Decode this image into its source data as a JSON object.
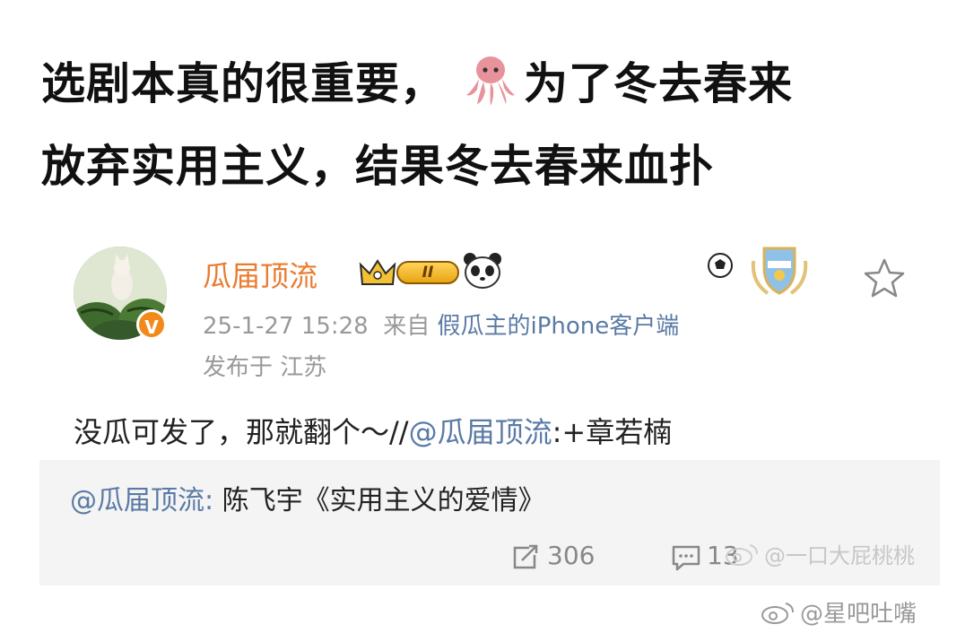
{
  "headline": {
    "line1_before_icon": "选剧本真的很重要，",
    "line1_after_icon": "为了冬去春来",
    "line2": "放弃实用主义，结果冬去春来血扑",
    "inline_icon": "octopus-emoji-icon"
  },
  "post": {
    "username": "瓜届顶流",
    "level_badge": "II",
    "timestamp": "25-1-27 15:28",
    "source_prefix": "来自",
    "source_client": "假瓜主的iPhone客户端",
    "location": "发布于 江苏",
    "content_text": "没瓜可发了，那就翻个～//",
    "content_mention": "@瓜届顶流",
    "content_tail": ":+章若楠",
    "verified_mark": "V",
    "icons": [
      "crown-icon",
      "panda-icon",
      "soccer-icon",
      "medal-icon",
      "star-icon"
    ],
    "accent_color": "#e97c2f",
    "link_color": "#5a7aa5"
  },
  "quote": {
    "mention": "@瓜届顶流:",
    "text": " 陈飞宇《实用主义的爱情》",
    "repost_count": "306",
    "comment_count": "13"
  },
  "watermarks": {
    "inner": "@一口大屁桃桃",
    "outer": "@星吧吐嘴"
  }
}
